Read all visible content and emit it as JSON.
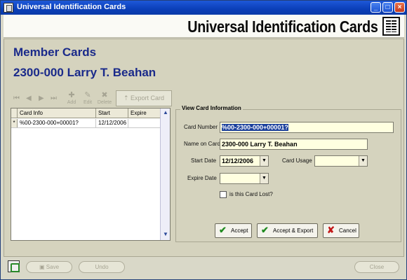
{
  "window": {
    "title": "Universal Identification Cards"
  },
  "banner": {
    "title": "Universal Identification Cards"
  },
  "header": {
    "section": "Member Cards",
    "member": "2300-000 Larry T. Beahan"
  },
  "toolbar": {
    "nav": {
      "first": "⏮",
      "prev": "◀",
      "next": "▶",
      "last": "⏭"
    },
    "add_label": "Add",
    "edit_label": "Edit",
    "delete_label": "Delete",
    "export_label": "Export Card"
  },
  "grid": {
    "columns": [
      "Card Info",
      "Start",
      "Expire"
    ],
    "rows": [
      {
        "marker": "*",
        "card_info": "%00-2300-000+00001?",
        "start": "12/12/2006",
        "expire": ""
      }
    ]
  },
  "view_card": {
    "legend": "View Card Information",
    "card_number_label": "Card Number",
    "card_number_value": "%00-2300-000+00001?",
    "name_label": "Name on Card",
    "name_value": "2300-000 Larry T. Beahan",
    "start_label": "Start Date",
    "start_value": "12/12/2006",
    "usage_label": "Card Usage",
    "usage_value": "",
    "expire_label": "Expire Date",
    "expire_value": "",
    "lost_label": "is this Card Lost?"
  },
  "actions": {
    "accept": "Accept",
    "accept_export": "Accept & Export",
    "cancel": "Cancel"
  },
  "footer": {
    "save": "Save",
    "undo": "Undo",
    "close": "Close"
  },
  "colors": {
    "title_blue": "#1a2a8a",
    "selection": "#1a3f9c",
    "field_bg": "#ffffe0"
  }
}
